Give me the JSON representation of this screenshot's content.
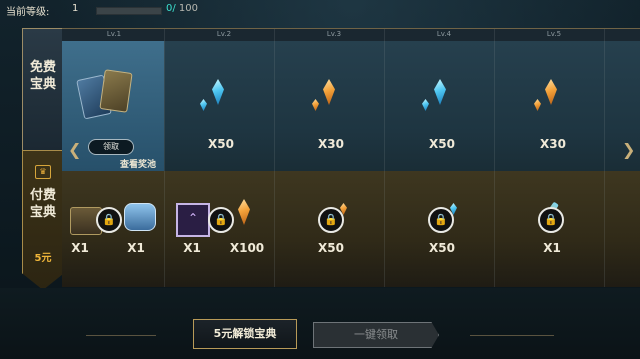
{
  "header": {
    "level_label": "当前等级:",
    "level_value": "1",
    "xp_current": "0/",
    "xp_max": "100",
    "xp_progress": 0
  },
  "tabs": {
    "free": "免费宝典",
    "paid": "付费宝典",
    "paid_price": "5元"
  },
  "levels": [
    "Lv.1",
    "Lv.2",
    "Lv.3",
    "Lv.4",
    "Lv.5"
  ],
  "free_rewards": [
    {
      "item": "card-pack",
      "qty": "",
      "action": "领取"
    },
    {
      "item": "blue-crystal",
      "qty": "X50"
    },
    {
      "item": "orange-crystal",
      "qty": "X30"
    },
    {
      "item": "blue-crystal",
      "qty": "X50"
    },
    {
      "item": "orange-crystal",
      "qty": "X30"
    }
  ],
  "paid_rewards": [
    {
      "items": [
        "treasure-chest",
        "hextech-chest"
      ],
      "qtys": [
        "X1",
        "X1"
      ],
      "locked": true
    },
    {
      "items": [
        "rank-emblem",
        "orange-crystal"
      ],
      "qtys": [
        "X1",
        "X100"
      ],
      "locked": true
    },
    {
      "items": [
        "orange-shard"
      ],
      "qtys": [
        "X50"
      ],
      "locked": true
    },
    {
      "items": [
        "blue-shard"
      ],
      "qtys": [
        "X50"
      ],
      "locked": true
    },
    {
      "items": [
        "key-fragment"
      ],
      "qtys": [
        "X1"
      ],
      "locked": true
    }
  ],
  "pool_link": "查看奖池",
  "buttons": {
    "unlock": "5元解锁宝典",
    "claim_all": "一键领取"
  },
  "colors": {
    "accent_gold": "#b89a58",
    "xp_cyan": "#3be0cf",
    "price_gold": "#f0b63a"
  }
}
